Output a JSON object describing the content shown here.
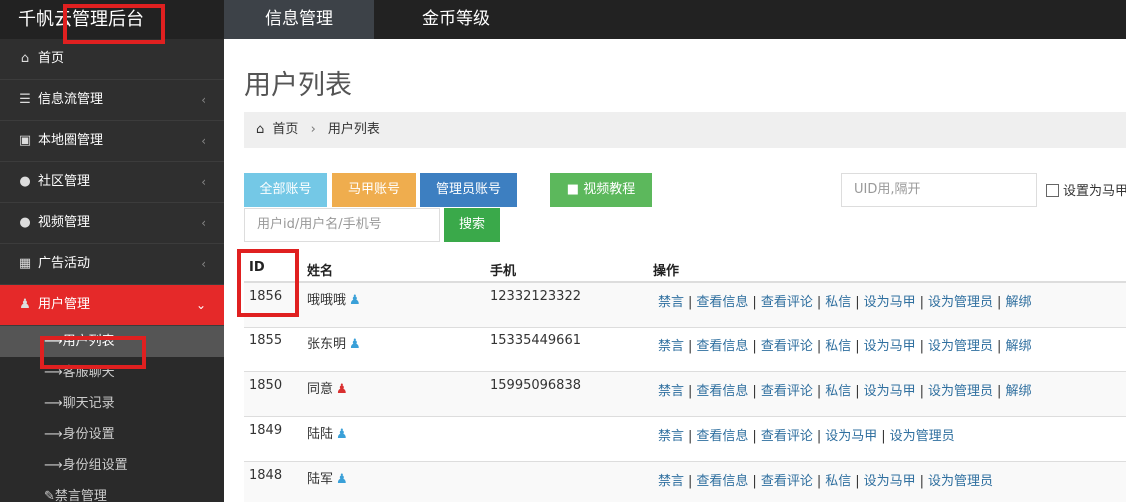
{
  "brand": {
    "title": "千帆云管理后台"
  },
  "topnav": [
    "信息管理",
    "金币等级"
  ],
  "sidebar": {
    "items": [
      {
        "label": "首页",
        "icon": "home-icon"
      },
      {
        "label": "信息流管理",
        "icon": "list-icon"
      },
      {
        "label": "本地圈管理",
        "icon": "camera-icon"
      },
      {
        "label": "社区管理",
        "icon": "users-icon"
      },
      {
        "label": "视频管理",
        "icon": "users-icon"
      },
      {
        "label": "广告活动",
        "icon": "calendar-icon"
      },
      {
        "label": "用户管理",
        "icon": "user-icon"
      }
    ],
    "subitems": [
      "用户列表",
      "客服聊天",
      "聊天记录",
      "身份设置",
      "身份组设置",
      "禁言管理"
    ]
  },
  "page": {
    "title": "用户列表"
  },
  "breadcrumb": {
    "home": "首页",
    "current": "用户列表"
  },
  "toolbar": {
    "all_accounts": "全部账号",
    "majia_accounts": "马甲账号",
    "admin_accounts": "管理员账号",
    "video_tutorial": "视频教程",
    "uid_placeholder": "UID用,隔开",
    "set_majia_label": "设置为马甲",
    "search_placeholder": "用户id/用户名/手机号",
    "search_button": "搜索"
  },
  "table": {
    "headers": {
      "id": "ID",
      "name": "姓名",
      "phone": "手机",
      "ops": "操作"
    },
    "op_labels": {
      "mute": "禁言",
      "view_info": "查看信息",
      "view_comments": "查看评论",
      "message": "私信",
      "set_majia": "设为马甲",
      "set_admin": "设为管理员",
      "unbind": "解绑"
    },
    "rows": [
      {
        "id": "1856",
        "name": "哦哦哦",
        "gender": "male",
        "phone": "12332123322",
        "ops": [
          "mute",
          "view_info",
          "view_comments",
          "message",
          "set_majia",
          "set_admin",
          "unbind"
        ]
      },
      {
        "id": "1855",
        "name": "张东明",
        "gender": "male",
        "phone": "15335449661",
        "ops": [
          "mute",
          "view_info",
          "view_comments",
          "message",
          "set_majia",
          "set_admin",
          "unbind"
        ]
      },
      {
        "id": "1850",
        "name": "同意",
        "gender": "female",
        "phone": "15995096838",
        "ops": [
          "mute",
          "view_info",
          "view_comments",
          "message",
          "set_majia",
          "set_admin",
          "unbind"
        ]
      },
      {
        "id": "1849",
        "name": "陆陆",
        "gender": "male",
        "phone": "",
        "ops": [
          "mute",
          "view_info",
          "view_comments",
          "set_majia",
          "set_admin"
        ]
      },
      {
        "id": "1848",
        "name": "陆军",
        "gender": "male",
        "phone": "",
        "ops": [
          "mute",
          "view_info",
          "view_comments",
          "message",
          "set_majia",
          "set_admin"
        ]
      }
    ]
  },
  "colors": {
    "accent": "#e52929",
    "sidebar": "#2f2f2f",
    "topbar": "#222222",
    "link": "#2f6f9f"
  }
}
